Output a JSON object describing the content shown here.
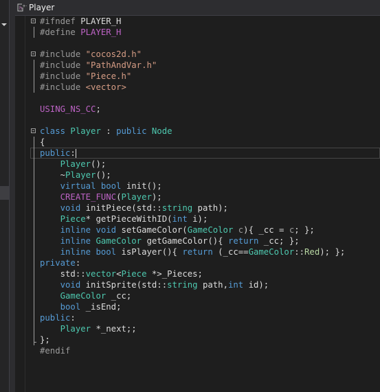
{
  "tab": {
    "title": "Player",
    "icon": "cpp-header-icon"
  },
  "code_lines": [
    [
      [
        "pp",
        "#ifndef "
      ],
      [
        "pl",
        "PLAYER_H"
      ]
    ],
    [
      [
        "pp",
        "#define "
      ],
      [
        "macro",
        "PLAYER_H"
      ]
    ],
    [],
    [
      [
        "pp",
        "#include "
      ],
      [
        "str",
        "\"cocos2d.h\""
      ]
    ],
    [
      [
        "pp",
        "#include "
      ],
      [
        "str",
        "\"PathAndVar.h\""
      ]
    ],
    [
      [
        "pp",
        "#include "
      ],
      [
        "str",
        "\"Piece.h\""
      ]
    ],
    [
      [
        "pp",
        "#include "
      ],
      [
        "str",
        "<vector>"
      ]
    ],
    [],
    [
      [
        "macro",
        "USING_NS_CC"
      ],
      [
        "pl",
        ";"
      ]
    ],
    [],
    [
      [
        "kw",
        "class "
      ],
      [
        "type",
        "Player"
      ],
      [
        "pl",
        " : "
      ],
      [
        "kw",
        "public "
      ],
      [
        "type",
        "Node"
      ]
    ],
    [
      [
        "pl",
        "{"
      ]
    ],
    [
      [
        "kw",
        "public"
      ],
      [
        "pl",
        ":"
      ]
    ],
    [
      [
        "pl",
        "    "
      ],
      [
        "type",
        "Player"
      ],
      [
        "pl",
        "();"
      ]
    ],
    [
      [
        "pl",
        "    ~"
      ],
      [
        "type",
        "Player"
      ],
      [
        "pl",
        "();"
      ]
    ],
    [
      [
        "pl",
        "    "
      ],
      [
        "kw",
        "virtual bool "
      ],
      [
        "pl",
        "init();"
      ]
    ],
    [
      [
        "pl",
        "    "
      ],
      [
        "macro",
        "CREATE_FUNC"
      ],
      [
        "pl",
        "("
      ],
      [
        "type",
        "Player"
      ],
      [
        "pl",
        ");"
      ]
    ],
    [
      [
        "pl",
        "    "
      ],
      [
        "kw",
        "void "
      ],
      [
        "pl",
        "initPiece(std::"
      ],
      [
        "type",
        "string"
      ],
      [
        "pl",
        " path);"
      ]
    ],
    [
      [
        "pl",
        "    "
      ],
      [
        "type",
        "Piece"
      ],
      [
        "pl",
        "* getPieceWithID("
      ],
      [
        "kw",
        "int "
      ],
      [
        "pl",
        "i);"
      ]
    ],
    [
      [
        "pl",
        "    "
      ],
      [
        "kw",
        "inline void "
      ],
      [
        "pl",
        "setGameColor("
      ],
      [
        "type",
        "GameColor "
      ],
      [
        "param",
        "c"
      ],
      [
        "pl",
        "){ _cc = "
      ],
      [
        "param",
        "c"
      ],
      [
        "pl",
        "; };"
      ]
    ],
    [
      [
        "pl",
        "    "
      ],
      [
        "kw",
        "inline "
      ],
      [
        "type",
        "GameColor "
      ],
      [
        "pl",
        "getGameColor(){ "
      ],
      [
        "kw",
        "return "
      ],
      [
        "pl",
        "_cc; };"
      ]
    ],
    [
      [
        "pl",
        "    "
      ],
      [
        "kw",
        "inline bool "
      ],
      [
        "pl",
        "isPlayer(){ "
      ],
      [
        "kw",
        "return "
      ],
      [
        "pl",
        "(_cc=="
      ],
      [
        "type",
        "GameColor"
      ],
      [
        "pl",
        "::"
      ],
      [
        "en",
        "Red"
      ],
      [
        "pl",
        "); };"
      ]
    ],
    [
      [
        "kw",
        "private"
      ],
      [
        "pl",
        ":"
      ]
    ],
    [
      [
        "pl",
        "    std::"
      ],
      [
        "type",
        "vector"
      ],
      [
        "pl",
        "<"
      ],
      [
        "type",
        "Piece"
      ],
      [
        "pl",
        " *>_Pieces;"
      ]
    ],
    [
      [
        "pl",
        "    "
      ],
      [
        "kw",
        "void "
      ],
      [
        "pl",
        "initSprite(std::"
      ],
      [
        "type",
        "string"
      ],
      [
        "pl",
        " path,"
      ],
      [
        "kw",
        "int "
      ],
      [
        "pl",
        "id);"
      ]
    ],
    [
      [
        "pl",
        "    "
      ],
      [
        "type",
        "GameColor "
      ],
      [
        "pl",
        "_cc;"
      ]
    ],
    [
      [
        "pl",
        "    "
      ],
      [
        "kw",
        "bool "
      ],
      [
        "pl",
        "_isEnd;"
      ]
    ],
    [
      [
        "kw",
        "public"
      ],
      [
        "pl",
        ":"
      ]
    ],
    [
      [
        "pl",
        "    "
      ],
      [
        "type",
        "Player "
      ],
      [
        "pl",
        "*_next;;"
      ]
    ],
    [
      [
        "pl",
        "};"
      ]
    ],
    [
      [
        "pp",
        "#endif"
      ]
    ]
  ],
  "colors": {
    "background": "#1e1e1e",
    "keyword": "#569cd6",
    "type": "#4ec9b0",
    "string": "#d69d85",
    "macro": "#bd63c5",
    "preprocessor": "#9b9b9b",
    "enum": "#b8d7a3",
    "text": "#dcdcdc"
  }
}
